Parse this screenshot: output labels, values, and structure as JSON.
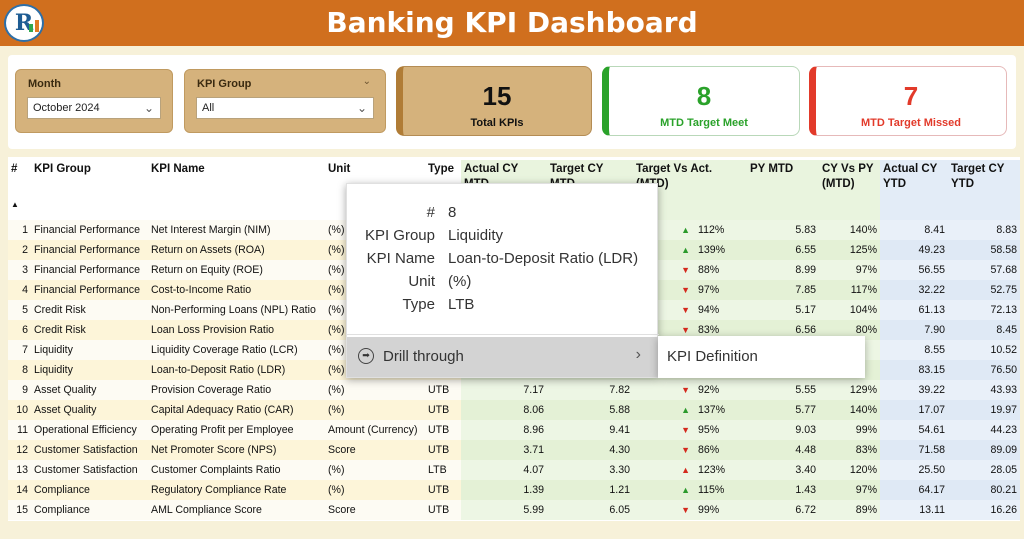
{
  "header": {
    "title": "Banking KPI Dashboard",
    "logo_letter": "R"
  },
  "slicers": {
    "month": {
      "label": "Month",
      "value": "October 2024"
    },
    "kpi_group": {
      "label": "KPI Group",
      "value": "All"
    }
  },
  "cards": {
    "total": {
      "value": "15",
      "label": "Total KPIs"
    },
    "meet": {
      "value": "8",
      "label": "MTD Target Meet",
      "color": "#2aa22a"
    },
    "missed": {
      "value": "7",
      "label": "MTD Target Missed",
      "color": "#e23a2a"
    }
  },
  "table": {
    "columns": [
      "#",
      "KPI Group",
      "KPI Name",
      "Unit",
      "Type",
      "Actual CY MTD",
      "Target CY MTD",
      "Target Vs Act. (MTD)",
      "PY MTD",
      "CY Vs PY (MTD)",
      "Actual CY YTD",
      "Target CY YTD"
    ],
    "rows": [
      {
        "n": "1",
        "group": "Financial Performance",
        "name": "Net Interest Margin (NIM)",
        "unit": "(%)",
        "type": "",
        "act": "",
        "tgt": "",
        "dir": "up",
        "tva": "112%",
        "py": "5.83",
        "cvp": "140%",
        "ytd": "8.41",
        "tytd": "8.83"
      },
      {
        "n": "2",
        "group": "Financial Performance",
        "name": "Return on Assets (ROA)",
        "unit": "(%)",
        "type": "",
        "act": "",
        "tgt": "",
        "dir": "up",
        "tva": "139%",
        "py": "6.55",
        "cvp": "125%",
        "ytd": "49.23",
        "tytd": "58.58"
      },
      {
        "n": "3",
        "group": "Financial Performance",
        "name": "Return on Equity (ROE)",
        "unit": "(%)",
        "type": "",
        "act": "",
        "tgt": "",
        "dir": "down",
        "tva": "88%",
        "py": "8.99",
        "cvp": "97%",
        "ytd": "56.55",
        "tytd": "57.68"
      },
      {
        "n": "4",
        "group": "Financial Performance",
        "name": "Cost-to-Income Ratio",
        "unit": "(%)",
        "type": "",
        "act": "",
        "tgt": "",
        "dir": "down",
        "tva": "97%",
        "py": "7.85",
        "cvp": "117%",
        "ytd": "32.22",
        "tytd": "52.75"
      },
      {
        "n": "5",
        "group": "Credit Risk",
        "name": "Non-Performing Loans (NPL) Ratio",
        "unit": "(%)",
        "type": "",
        "act": "",
        "tgt": "",
        "dir": "down",
        "tva": "94%",
        "py": "5.17",
        "cvp": "104%",
        "ytd": "61.13",
        "tytd": "72.13"
      },
      {
        "n": "6",
        "group": "Credit Risk",
        "name": "Loan Loss Provision Ratio",
        "unit": "(%)",
        "type": "",
        "act": "",
        "tgt": "",
        "dir": "down",
        "tva": "83%",
        "py": "6.56",
        "cvp": "80%",
        "ytd": "7.90",
        "tytd": "8.45"
      },
      {
        "n": "7",
        "group": "Liquidity",
        "name": "Liquidity Coverage Ratio (LCR)",
        "unit": "(%)",
        "type": "",
        "act": "",
        "tgt": "",
        "dir": "",
        "tva": "",
        "py": "",
        "cvp": "",
        "ytd": "8.55",
        "tytd": "10.52"
      },
      {
        "n": "8",
        "group": "Liquidity",
        "name": "Loan-to-Deposit Ratio (LDR)",
        "unit": "(%)",
        "type": "",
        "act": "",
        "tgt": "",
        "dir": "",
        "tva": "",
        "py": "",
        "cvp": "",
        "ytd": "83.15",
        "tytd": "76.50"
      },
      {
        "n": "9",
        "group": "Asset Quality",
        "name": "Provision Coverage Ratio",
        "unit": "(%)",
        "type": "UTB",
        "act": "7.17",
        "tgt": "7.82",
        "dir": "down",
        "tva": "92%",
        "py": "5.55",
        "cvp": "129%",
        "ytd": "39.22",
        "tytd": "43.93"
      },
      {
        "n": "10",
        "group": "Asset Quality",
        "name": "Capital Adequacy Ratio (CAR)",
        "unit": "(%)",
        "type": "UTB",
        "act": "8.06",
        "tgt": "5.88",
        "dir": "up",
        "tva": "137%",
        "py": "5.77",
        "cvp": "140%",
        "ytd": "17.07",
        "tytd": "19.97"
      },
      {
        "n": "11",
        "group": "Operational Efficiency",
        "name": "Operating Profit per Employee",
        "unit": "Amount (Currency)",
        "type": "UTB",
        "act": "8.96",
        "tgt": "9.41",
        "dir": "down",
        "tva": "95%",
        "py": "9.03",
        "cvp": "99%",
        "ytd": "54.61",
        "tytd": "44.23"
      },
      {
        "n": "12",
        "group": "Customer Satisfaction",
        "name": "Net Promoter Score (NPS)",
        "unit": "Score",
        "type": "UTB",
        "act": "3.71",
        "tgt": "4.30",
        "dir": "down",
        "tva": "86%",
        "py": "4.48",
        "cvp": "83%",
        "ytd": "71.58",
        "tytd": "89.09"
      },
      {
        "n": "13",
        "group": "Customer Satisfaction",
        "name": "Customer Complaints Ratio",
        "unit": "(%)",
        "type": "LTB",
        "act": "4.07",
        "tgt": "3.30",
        "dir": "up-red",
        "tva": "123%",
        "py": "3.40",
        "cvp": "120%",
        "ytd": "25.50",
        "tytd": "28.05"
      },
      {
        "n": "14",
        "group": "Compliance",
        "name": "Regulatory Compliance Rate",
        "unit": "(%)",
        "type": "UTB",
        "act": "1.39",
        "tgt": "1.21",
        "dir": "up",
        "tva": "115%",
        "py": "1.43",
        "cvp": "97%",
        "ytd": "64.17",
        "tytd": "80.21"
      },
      {
        "n": "15",
        "group": "Compliance",
        "name": "AML Compliance Score",
        "unit": "Score",
        "type": "UTB",
        "act": "5.99",
        "tgt": "6.05",
        "dir": "down",
        "tva": "99%",
        "py": "6.72",
        "cvp": "89%",
        "ytd": "13.11",
        "tytd": "16.26"
      }
    ]
  },
  "tooltip": {
    "fields": [
      {
        "key": "#",
        "value": "8"
      },
      {
        "key": "KPI Group",
        "value": "Liquidity"
      },
      {
        "key": "KPI Name",
        "value": "Loan-to-Deposit Ratio (LDR)"
      },
      {
        "key": "Unit",
        "value": "(%)"
      },
      {
        "key": "Type",
        "value": "LTB"
      }
    ],
    "drill_label": "Drill through",
    "submenu_item": "KPI Definition"
  },
  "colors": {
    "header": "#d06f1e",
    "green": "#2aa22a",
    "red": "#e23a2a",
    "accent": "#d5b27c"
  }
}
